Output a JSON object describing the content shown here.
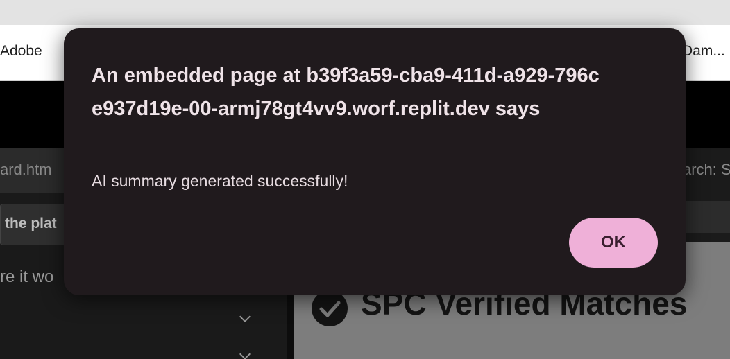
{
  "browser": {
    "bookmark_left": "Adobe",
    "bookmark_right": "Dam..."
  },
  "app": {
    "left_panel": {
      "url_fragment": "ard.htm",
      "input_fragment": "the plat",
      "hint_fragment": "re it wo"
    },
    "right_panel": {
      "search_fragment": "arch: S",
      "card_title": "SPC Verified Matches"
    }
  },
  "dialog": {
    "title": "An embedded page at b39f3a59-cba9-411d-a929-796ce937d19e-00-armj78gt4vv9.worf.replit.dev says",
    "message": "AI summary generated successfully!",
    "ok_label": "OK"
  },
  "icons": {
    "card_icon": "check-circle-icon",
    "expand_icon": "chevron-down-icon"
  },
  "colors": {
    "dialog_background": "#201a1d",
    "ok_button": "#efb0d8"
  }
}
